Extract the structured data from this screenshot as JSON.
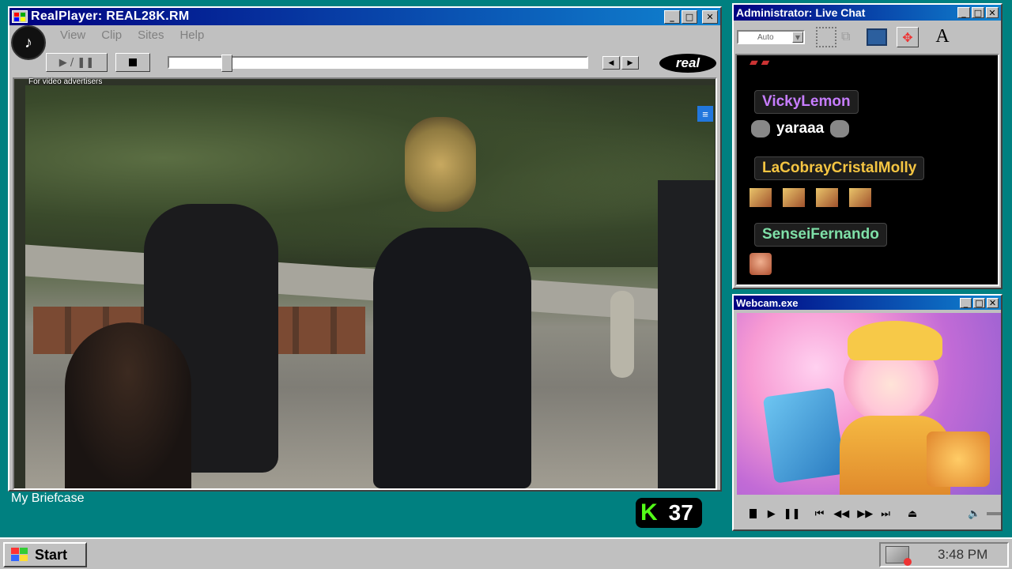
{
  "realplayer": {
    "title": "RealPlayer: REAL28K.RM",
    "menu": [
      "View",
      "Clip",
      "Sites",
      "Help"
    ],
    "caption": "For video advertisers",
    "logo": "real"
  },
  "chat": {
    "title": "Administrator: Live Chat",
    "auto_select": "Auto",
    "font_button": "A",
    "messages": [
      {
        "user": "VickyLemon",
        "color": "#c77dff",
        "text": "yaraaa"
      },
      {
        "user": "LaCobrayCristalMolly",
        "color": "#f5c542",
        "text": ""
      },
      {
        "user": "SenseiFernando",
        "color": "#7fe0a8",
        "text": ""
      }
    ]
  },
  "webcam": {
    "title": "Webcam.exe"
  },
  "desktop": {
    "briefcase_label": "My Briefcase",
    "kick_count": "37",
    "kick_letter": "K"
  },
  "taskbar": {
    "start_label": "Start",
    "clock": "3:48 PM"
  },
  "colors": {
    "desktop": "#008080",
    "titlebar_active": "#000080",
    "kick_green": "#53fc18"
  }
}
